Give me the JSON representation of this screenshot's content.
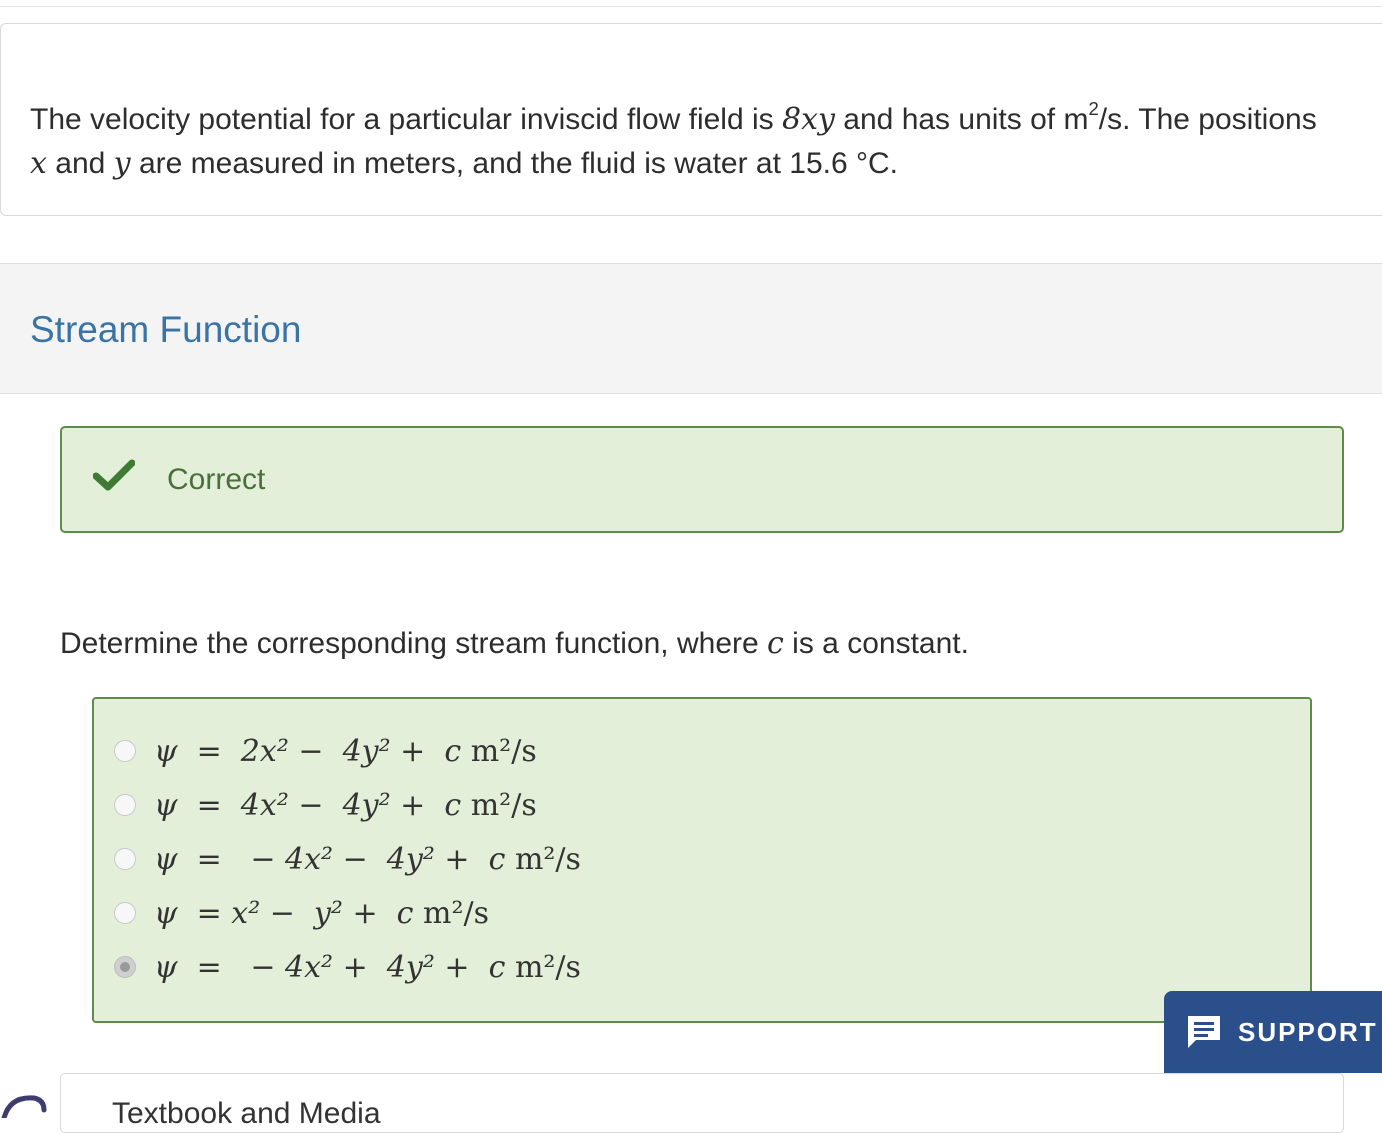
{
  "problem": {
    "text_1": "The velocity potential for a particular inviscid flow field is ",
    "expr": "8xy",
    "text_2": " and has units of m",
    "unit_exp": "2",
    "text_3": "/s. The positions",
    "var_x": "x",
    "text_4": " and ",
    "var_y": "y",
    "text_5": " are measured in meters, and the fluid is water at 15.6 °C."
  },
  "section": {
    "title": "Stream Function"
  },
  "feedback": {
    "icon": "checkmark-icon",
    "label": "Correct",
    "color": "#4b6f3a"
  },
  "question": {
    "text_1": "Determine the corresponding stream function, where ",
    "var_c": "c",
    "text_2": " is a constant."
  },
  "options": [
    {
      "expr": "ψ  =  2x² −  4y² +  c",
      "unit": " m²/s",
      "selected": false
    },
    {
      "expr": "ψ  =  4x² −  4y² +  c",
      "unit": " m²/s",
      "selected": false
    },
    {
      "expr": "ψ  =   − 4x² −  4y² +  c",
      "unit": " m²/s",
      "selected": false
    },
    {
      "expr": "ψ  = x² −  y² +  c",
      "unit": " m²/s",
      "selected": false
    },
    {
      "expr": "ψ  =   − 4x² +  4y² +  c",
      "unit": " m²/s",
      "selected": true
    }
  ],
  "support": {
    "label": "SUPPORT",
    "icon": "chat-message-icon",
    "color": "#2b4f8a"
  },
  "next_card": {
    "title": "Textbook and Media"
  }
}
